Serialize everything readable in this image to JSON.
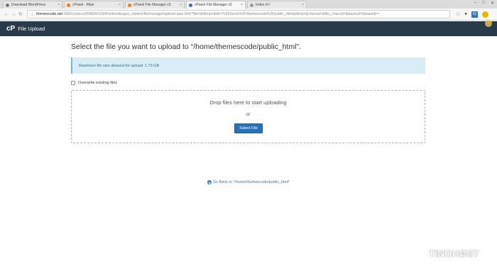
{
  "browser": {
    "tabs": [
      {
        "label": "Download WordPress",
        "active": false,
        "favicon_color": "#777777"
      },
      {
        "label": "cPanel - Main",
        "active": false,
        "favicon_color": "#f07c1e"
      },
      {
        "label": "cPanel File Manager v3",
        "active": false,
        "favicon_color": "#f07c1e"
      },
      {
        "label": "cPanel File Manager v3",
        "active": true,
        "favicon_color": "#3a6ea5"
      },
      {
        "label": "Index of /",
        "active": false,
        "favicon_color": "#999999"
      }
    ],
    "url_host": "themescode.net",
    "url_path": ":2082/cpsess2698066109/frontend/paper_lantern/filemanager/upload-ajax.html?file=&fileop=&dir=%2Fhome%2Fthemescode%2Fpublic_html&dirop=&charset=&file_charset=&baseurl=&basedir=",
    "ext_badge": "IQ"
  },
  "app": {
    "title": "File Upload"
  },
  "main": {
    "heading": "Select the file you want to upload to “/home/themescode/public_html”.",
    "max_size_text": "Maximum file size allowed for upload: 1.73 GB",
    "overwrite_label": "Overwrite existing files",
    "drop_text": "Drop files here to start uploading",
    "or_text": "or",
    "select_button": "Select File",
    "go_back_text": "Go Back to “/home/themescode/public_html”"
  },
  "watermark": {
    "text_part1": "TINO",
    "text_part2": "HØST"
  }
}
